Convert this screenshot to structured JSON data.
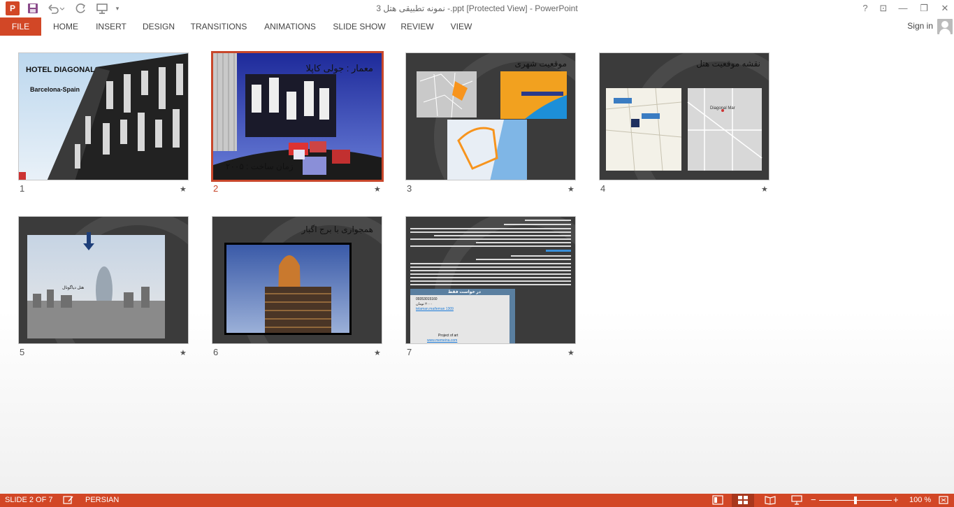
{
  "window": {
    "title": "نمونه تطبیقی هتل 3 -.ppt [Protected View] - PowerPoint",
    "help": "?",
    "controls": [
      "⊡",
      "—",
      "❐",
      "✕"
    ]
  },
  "ribbon": {
    "file": "FILE",
    "tabs": [
      "HOME",
      "INSERT",
      "DESIGN",
      "TRANSITIONS",
      "ANIMATIONS",
      "SLIDE SHOW",
      "REVIEW",
      "VIEW"
    ],
    "sign_in": "Sign in"
  },
  "slides": [
    {
      "number": "1",
      "title": "HOTEL DIAGONAL",
      "subtitle": "Barcelona-Spain"
    },
    {
      "number": "2",
      "title": "معمار : جولی کاپلا",
      "subtitle": "زمان ساخت : ۲۰۰۵"
    },
    {
      "number": "3",
      "title": "موقعیت شهری"
    },
    {
      "number": "4",
      "title": "نقشه موقعیت هتل",
      "map_label": "Diagonal Mar"
    },
    {
      "number": "5",
      "caption": "هتل دیاگونال"
    },
    {
      "number": "6",
      "title": "همجواری با برج اگبار"
    },
    {
      "number": "7",
      "table_header": "در خواست فقط",
      "rows": [
        "09353015160",
        "۲۰۰۰ تومان",
        "telaman.ma/teman 1309",
        "Project of art",
        "www.memeina.com"
      ]
    }
  ],
  "status": {
    "slide_of": "SLIDE 2 OF 7",
    "language": "PERSIAN",
    "zoom": "100 %"
  }
}
